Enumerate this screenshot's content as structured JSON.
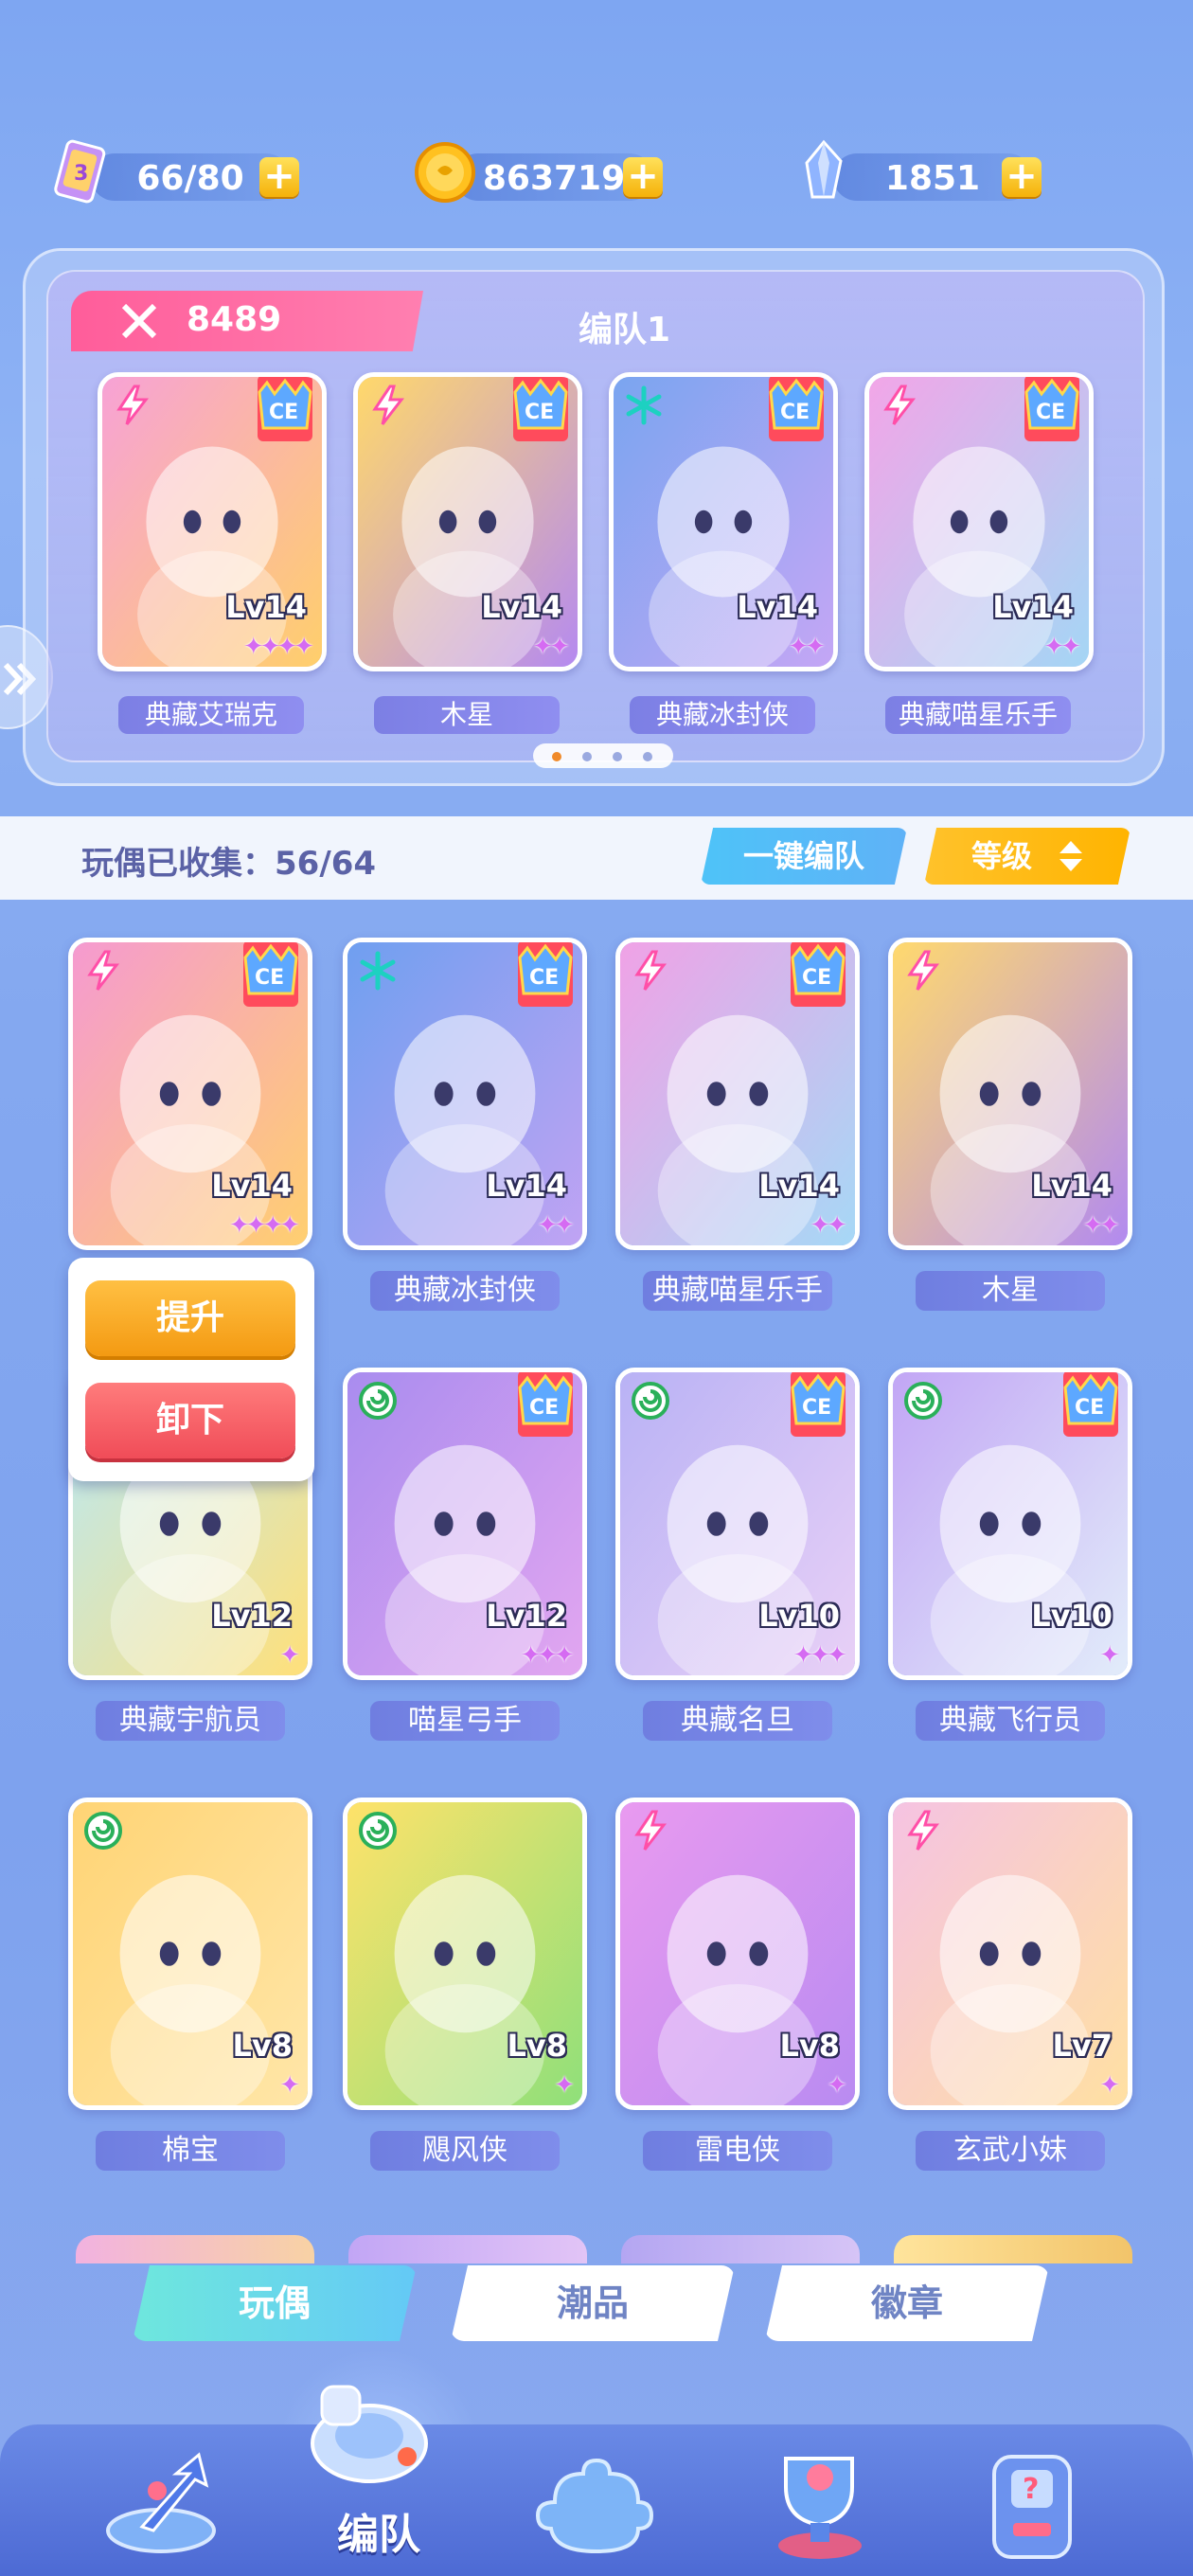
{
  "resources": [
    {
      "name": "stamina",
      "value": "66/80",
      "icon": "energy-card-icon"
    },
    {
      "name": "coins",
      "value": "863719",
      "icon": "gold-coin-icon"
    },
    {
      "name": "gems",
      "value": "1851",
      "icon": "crystal-icon"
    }
  ],
  "team": {
    "power": "8489",
    "name": "编队1",
    "members": [
      {
        "name": "典藏艾瑞克",
        "level": "Lv14",
        "stars": "✦✦✦✦",
        "element": "lightning",
        "colors": [
          "#f7a2d6",
          "#ffcf6b"
        ]
      },
      {
        "name": "木星",
        "level": "Lv14",
        "stars": "✦✦",
        "element": "lightning",
        "colors": [
          "#ffd86b",
          "#b58af0"
        ]
      },
      {
        "name": "典藏冰封侠",
        "level": "Lv14",
        "stars": "✦✦",
        "element": "ice",
        "colors": [
          "#7aa5f0",
          "#c4a6f5"
        ]
      },
      {
        "name": "典藏喵星乐手",
        "level": "Lv14",
        "stars": "✦✦",
        "element": "lightning",
        "colors": [
          "#f2a6e8",
          "#a4d6f5"
        ]
      }
    ],
    "page_dots": 4,
    "active_dot": 0
  },
  "collection": {
    "label": "玩偶已收集：56/64",
    "one_click_label": "一键编队",
    "sort_label": "等级"
  },
  "popup": {
    "upgrade_label": "提升",
    "unequip_label": "卸下"
  },
  "grid": [
    {
      "name": "典藏艾瑞克",
      "level": "Lv14",
      "stars": "✦✦✦✦",
      "element": "lightning",
      "badge": true,
      "colors": [
        "#f59ad0",
        "#ffcf70"
      ]
    },
    {
      "name": "典藏冰封侠",
      "level": "Lv14",
      "stars": "✦✦",
      "element": "ice",
      "badge": true,
      "colors": [
        "#6f9ff0",
        "#c0a3f3"
      ]
    },
    {
      "name": "典藏喵星乐手",
      "level": "Lv14",
      "stars": "✦✦",
      "element": "lightning",
      "badge": true,
      "colors": [
        "#f0a2e6",
        "#a6d8f6"
      ]
    },
    {
      "name": "木星",
      "level": "Lv14",
      "stars": "✦✦",
      "element": "lightning",
      "badge": false,
      "colors": [
        "#ffd96e",
        "#b28af0"
      ]
    },
    {
      "name": "典藏宇航员",
      "level": "Lv12",
      "stars": "✦",
      "element": "wind",
      "badge": false,
      "colors": [
        "#b9e9f7",
        "#ffe07a"
      ]
    },
    {
      "name": "喵星弓手",
      "level": "Lv12",
      "stars": "✦✦✦",
      "element": "wind",
      "badge": true,
      "colors": [
        "#a98cef",
        "#e2a6f0"
      ]
    },
    {
      "name": "典藏名旦",
      "level": "Lv10",
      "stars": "✦✦✦",
      "element": "wind",
      "badge": true,
      "colors": [
        "#b9b2f5",
        "#e8d0f6"
      ]
    },
    {
      "name": "典藏飞行员",
      "level": "Lv10",
      "stars": "✦",
      "element": "wind",
      "badge": true,
      "colors": [
        "#c2a6f5",
        "#e2ecfa"
      ]
    },
    {
      "name": "棉宝",
      "level": "Lv8",
      "stars": "✦",
      "element": "wind",
      "badge": false,
      "colors": [
        "#ffd475",
        "#ffe6a8"
      ]
    },
    {
      "name": "飓风侠",
      "level": "Lv8",
      "stars": "✦",
      "element": "wind",
      "badge": false,
      "colors": [
        "#ffe26a",
        "#8fe07a"
      ]
    },
    {
      "name": "雷电侠",
      "level": "Lv8",
      "stars": "✦",
      "element": "lightning",
      "badge": false,
      "colors": [
        "#e99af0",
        "#b98bf1"
      ]
    },
    {
      "name": "玄武小妹",
      "level": "Lv7",
      "stars": "✦",
      "element": "lightning",
      "badge": false,
      "colors": [
        "#f5c3e2",
        "#ffe0a2"
      ]
    }
  ],
  "tabs": [
    {
      "label": "玩偶",
      "active": true
    },
    {
      "label": "潮品",
      "active": false
    },
    {
      "label": "徽章",
      "active": false
    }
  ],
  "bottom_nav": {
    "active_label": "编队",
    "items": [
      "arrow-upgrade-icon",
      "whistle-team-icon",
      "puzzle-icon",
      "trophy-icon",
      "gacha-machine-icon"
    ]
  },
  "colors": {
    "lightning": "#ff4fa8",
    "ice": "#1dd1c1",
    "wind": "#2ab05a",
    "accent_gold": "#ffb400",
    "accent_blue": "#5fb2f7"
  }
}
